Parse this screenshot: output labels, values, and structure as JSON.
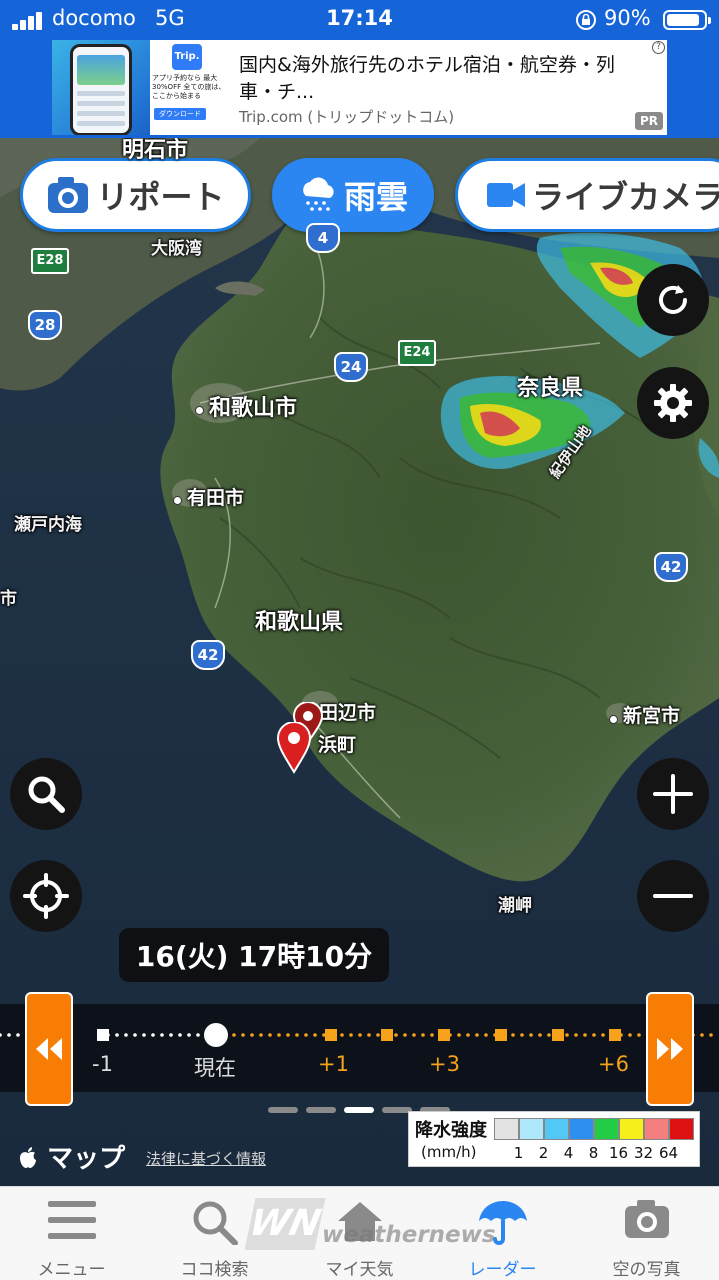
{
  "status_bar": {
    "carrier": "docomo",
    "network": "5G",
    "time": "17:14",
    "battery_pct": "90%",
    "battery_level": 0.9
  },
  "ad": {
    "thumb_logo": "Trip.",
    "thumb_promo": "アプリ予約なら 最大30%OFF 全ての旅は、ここから始まる",
    "thumb_button": "ダウンロード",
    "title": "国内&海外旅行先のホテル宿泊・航空券・列車・チ...",
    "advertiser": "Trip.com (トリップドットコム)",
    "info": "?",
    "pr": "PR"
  },
  "modes": {
    "report": "リポート",
    "rain": "雨雲",
    "live": "ライブカメラ"
  },
  "map_labels": {
    "akashi": "明石市",
    "osaka_bay": "大阪湾",
    "wakayama_city": "和歌山市",
    "arida": "有田市",
    "setonaikai": "瀬戸内海",
    "wakayama_pref": "和歌山県",
    "nara_pref": "奈良県",
    "tanabe": "田辺市",
    "shirahama": "浜町",
    "shingu": "新宮市",
    "shiomisaki": "潮岬",
    "kii_mountains": "紀伊山地",
    "edge_fragment": "市",
    "routes": {
      "r4": "4",
      "r24": "24",
      "r28": "28",
      "r42a": "42",
      "r42b": "42",
      "e24": "E24",
      "e28": "E28"
    }
  },
  "timestamp": "16(火) 17時10分",
  "timeline": {
    "labels": [
      "-1",
      "現在",
      "+1",
      "+3",
      "+6"
    ],
    "current_index": 1,
    "page_count": 5,
    "active_page": 2
  },
  "legend": {
    "title": "降水強度",
    "unit": "(mm/h)",
    "values": [
      "1",
      "2",
      "4",
      "8",
      "16",
      "32",
      "64"
    ],
    "colors": [
      "#e3e3e3",
      "#aee9fb",
      "#51c8f5",
      "#2f8ff0",
      "#22cc44",
      "#f5ef1a",
      "#f47f7f",
      "#dd1111"
    ]
  },
  "attribution": {
    "maps": "マップ",
    "legal": "法律に基づく情報"
  },
  "tabs": {
    "menu": "メニュー",
    "search": "ココ検索",
    "my_weather": "マイ天気",
    "radar": "レーダー",
    "sky_photo": "空の写真"
  },
  "watermark": {
    "mark": "WN",
    "text": "weathernews"
  },
  "colors": {
    "brand_blue": "#1565d8",
    "accent_blue": "#2b86f1",
    "timeline_orange": "#f77d05"
  }
}
